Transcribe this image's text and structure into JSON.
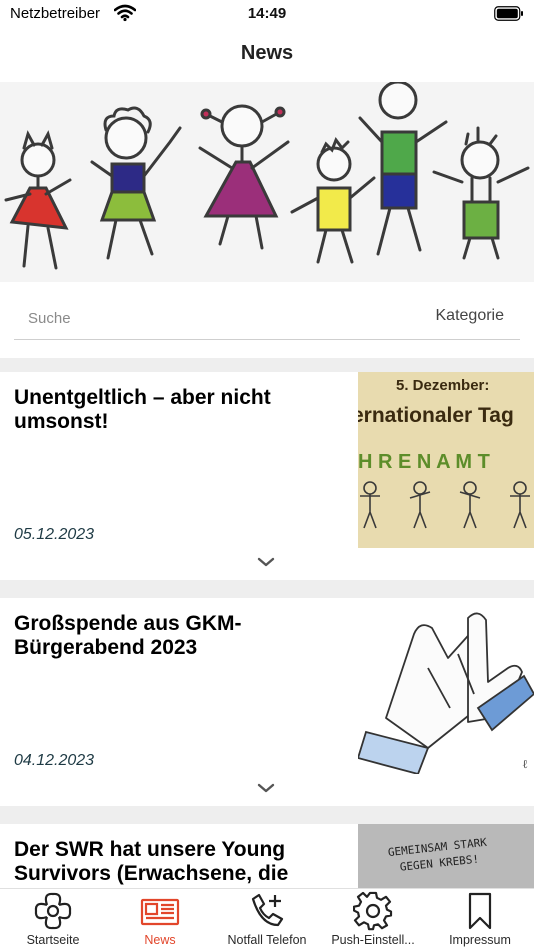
{
  "status_bar": {
    "carrier": "Netzbetreiber",
    "time": "14:49"
  },
  "header": {
    "title": "News"
  },
  "search": {
    "placeholder": "Suche",
    "category_label": "Kategorie"
  },
  "news": [
    {
      "title": "Unentgeltlich – aber nicht umsonst!",
      "date": "05.12.2023",
      "thumb": {
        "line1": "5. Dezember:",
        "line2": "ernationaler Tag",
        "line3": "H R E N A M T"
      }
    },
    {
      "title": "Großspende aus GKM-Bürgerabend 2023",
      "date": "04.12.2023",
      "thumb": {
        "signature": "ℓ"
      }
    },
    {
      "title": "Der SWR hat unsere Young Survivors (Erwachsene, die im",
      "date": "",
      "thumb": {
        "line1": "GEMEINSAM STARK",
        "line2": "GEGEN KREBS!"
      }
    }
  ],
  "tabs": [
    {
      "label": "Startseite",
      "icon": "flower-icon",
      "active": false
    },
    {
      "label": "News",
      "icon": "newspaper-icon",
      "active": true
    },
    {
      "label": "Notfall Telefon",
      "icon": "phone-plus-icon",
      "active": false
    },
    {
      "label": "Push-Einstell...",
      "icon": "gear-icon",
      "active": false
    },
    {
      "label": "Impressum",
      "icon": "bookmark-icon",
      "active": false
    }
  ],
  "colors": {
    "accent": "#e2462b",
    "card_date": "#1e3a44",
    "feed_background": "#eeeeee"
  }
}
